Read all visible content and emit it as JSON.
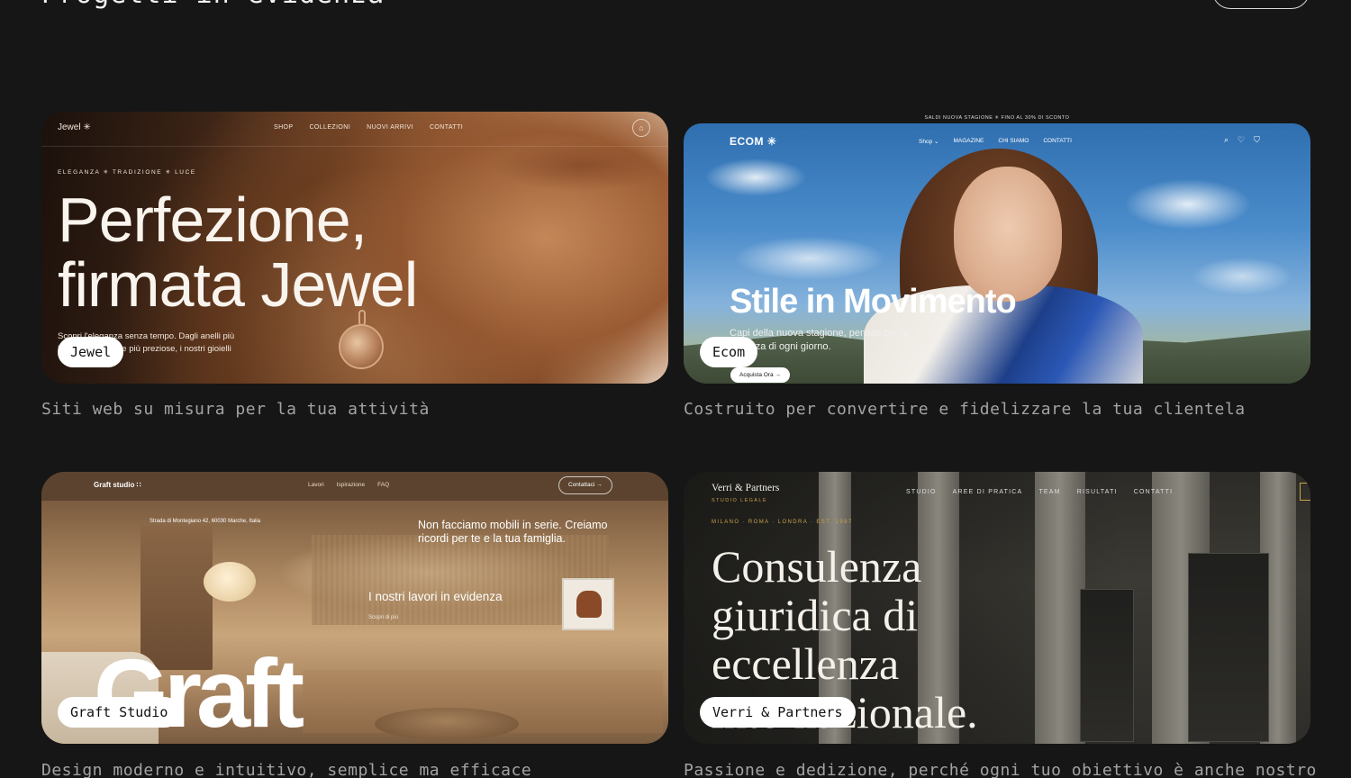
{
  "section": {
    "title": "Progetti in evidenza"
  },
  "projects": [
    {
      "pill": "Jewel",
      "caption": "Siti web su misura per la tua attività",
      "preview": {
        "logo": "Jewel ✳",
        "menu": [
          "SHOP",
          "COLLEZIONI",
          "NUOVI ARRIVI",
          "CONTATTI"
        ],
        "tags": "ELEGANZA  ✳  TRADIZIONE  ✳  LUCE",
        "headline_1": "Perfezione,",
        "headline_2": "firmata Jewel",
        "body": "Scopri l'eleganza senza tempo. Dagli anelli più iconici alle collane più preziose, i nostri gioielli"
      }
    },
    {
      "pill": "Ecom",
      "caption": "Costruito per convertire e fidelizzare la tua clientela",
      "preview": {
        "promo": "SALDI NUOVA STAGIONE  ✳  FINO AL 30% DI SCONTO",
        "logo": "ECOM ✳",
        "menu": [
          "Shop ⌄",
          "MAGAZINE",
          "CHI SIAMO",
          "CONTATTI"
        ],
        "headline": "Stile in Movimento",
        "body": "Capi della nuova stagione, pensati per la bellezza di ogni giorno.",
        "cta": "Acquista Ora →"
      }
    },
    {
      "pill": "Graft Studio",
      "caption": "Design moderno e intuitivo, semplice ma efficace",
      "preview": {
        "logo": "Graft studio ∷",
        "menu": [
          "Lavori",
          "Ispirazione",
          "FAQ"
        ],
        "contact": "Contattaci →",
        "address": "Strada di Montegiano 42, 60030 Marche, Italia",
        "quote": "Non facciamo mobili in serie. Creiamo ricordi per te e la tua famiglia.",
        "feature": "I nostri lavori in evidenza",
        "feature_sub": "Scopri di più",
        "big": "Graft"
      }
    },
    {
      "pill": "Verri & Partners",
      "caption": "Passione e dedizione, perché ogni tuo obiettivo è anche nostro",
      "preview": {
        "logo": "Verri & Partners",
        "logo_sub": "STUDIO LEGALE",
        "menu": [
          "STUDIO",
          "AREE DI PRATICA",
          "TEAM",
          "RISULTATI",
          "CONTATTI"
        ],
        "cities": "MILANO · ROMA · LONDRA · EST. 1987",
        "headline_1": "Consulenza",
        "headline_2": "giuridica di",
        "headline_3": "eccellenza",
        "headline_4": "internazionale."
      }
    }
  ]
}
